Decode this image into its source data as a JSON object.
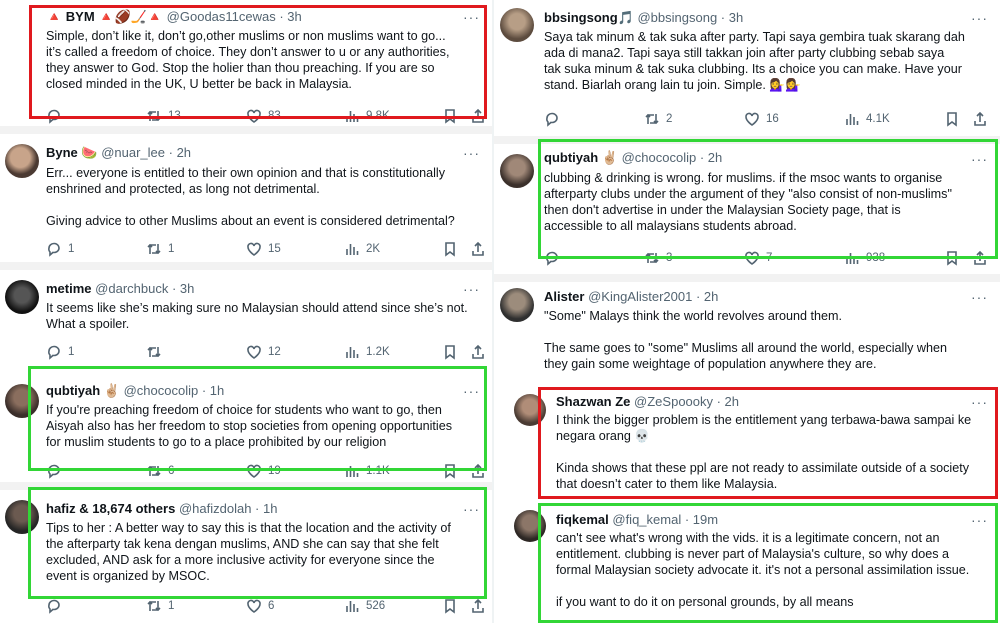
{
  "left": {
    "t1": {
      "name": "🔺 BYM 🔺🏈🏒🔺",
      "handle": "@Goodas11cewas · 3h",
      "text": "Simple, don’t like it, don’t go,other muslims or non muslims want to go...\nit’s called a freedom of choice. They don’t answer to u or any authorities,\nthey answer to God. Stop the holier than thou preaching. If you are so\nclosed minded in the UK, U better be back in Malaysia.",
      "replies": "",
      "retweets": "13",
      "likes": "83",
      "views": "9.8K"
    },
    "t2": {
      "name": "Byne 🍉",
      "handle": "@nuar_lee · 2h",
      "text": "Err... everyone is entitled to their own opinion and that is constitutionally\nenshrined and protected, as long not detrimental.\n\nGiving advice to other Muslims about an event is considered detrimental?",
      "replies": "1",
      "retweets": "1",
      "likes": "15",
      "views": "2K"
    },
    "t3": {
      "name": "metime",
      "handle": "@darchbuck · 3h",
      "text": "It seems like she’s making sure no Malaysian should attend since she’s not.\nWhat a spoiler.",
      "replies": "1",
      "retweets": "",
      "likes": "12",
      "views": "1.2K"
    },
    "t4": {
      "name": "qubtiyah ✌🏼",
      "handle": "@chococolip · 1h",
      "text": "If you're preaching freedom of choice for students who want to go, then\nAisyah also has her freedom to stop societies from opening opportunities\nfor muslim students to go to a place prohibited by our religion",
      "replies": "",
      "retweets": "6",
      "likes": "19",
      "views": "1.1K"
    },
    "t5": {
      "name": "hafiz & 18,674 others",
      "handle": "@hafizdolah · 1h",
      "text": "Tips to her : A better way to say this is that the location and the activity of\nthe afterparty tak kena dengan muslims, AND she can say that she felt\nexcluded, AND ask for a more inclusive activity for everyone since the\nevent is organized by MSOC.",
      "replies": "",
      "retweets": "1",
      "likes": "6",
      "views": "526"
    }
  },
  "right": {
    "t1": {
      "name": "bbsingsong🎵",
      "handle": "@bbsingsong · 3h",
      "text": "Saya tak minum & tak suka after party. Tapi saya gembira tuak skarang dah\nada di mana2. Tapi saya still takkan join after party clubbing sebab saya\ntak suka minum & tak suka clubbing. Its a choice you can make. Have your\nstand. Biarlah orang lain tu join. Simple. 💁‍♀️💁‍♀️",
      "replies": "",
      "retweets": "2",
      "likes": "16",
      "views": "4.1K"
    },
    "t2": {
      "name": "qubtiyah ✌🏼",
      "handle": "@chococolip · 2h",
      "text": "clubbing & drinking is wrong. for muslims. if the msoc wants to organise\nafterparty clubs under the argument of they \"also consist of non-muslims\"\nthen don't advertise in under the Malaysian Society page, that is\naccessible to all malaysians students abroad.",
      "replies": "",
      "retweets": "3",
      "likes": "7",
      "views": "938"
    },
    "t3": {
      "name": "Alister",
      "handle": "@KingAlister2001 · 2h",
      "text": "\"Some\" Malays think the world revolves around them.\n\nThe same goes to \"some\" Muslims all around the world, especially when\nthey gain some weightage of population anywhere they are."
    },
    "t4": {
      "name": "Shazwan Ze",
      "handle": "@ZeSpoooky · 2h",
      "text": "I think the bigger problem is the entitlement yang terbawa-bawa sampai ke\nnegara orang 💀\n\nKinda shows that these ppl are not ready to assimilate outside of a society\nthat doesn’t cater to them like Malaysia."
    },
    "t5": {
      "name": "fiqkemal",
      "handle": "@fiq_kemal · 19m",
      "text": "can't see what's wrong with the vids. it is a legitimate concern, not an\nentitlement. clubbing is never part of Malaysia's culture, so why does a\nformal Malaysian society advocate it.  it's not a personal assimilation issue.\n\nif you want to do it on personal grounds, by all means"
    }
  },
  "more_glyph": "···",
  "colors": {
    "red_box": "#e0191e",
    "green_box": "#32d636",
    "text": "#0f1419",
    "muted": "#536471"
  }
}
